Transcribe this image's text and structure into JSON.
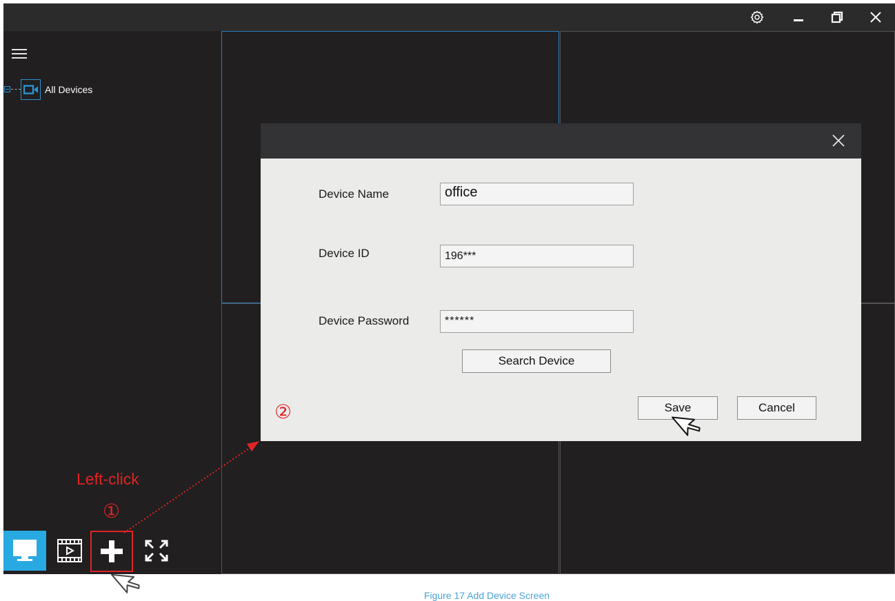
{
  "colors": {
    "accent": "#2a94d4",
    "annotation": "#e02424",
    "caption": "#4aa3d8"
  },
  "titlebar": {
    "icons": [
      "settings-icon",
      "minimize-icon",
      "restore-icon",
      "close-icon"
    ]
  },
  "sidebar": {
    "menu_icon": "hamburger-icon",
    "tree": {
      "root_label": "All Devices",
      "icon": "camera-icon"
    }
  },
  "toolbar": {
    "items": [
      "live-view-icon",
      "playback-icon",
      "add-device-icon",
      "fullscreen-icon"
    ]
  },
  "dialog": {
    "fields": [
      {
        "label": "Device Name",
        "value": "office"
      },
      {
        "label": "Device ID",
        "value": "196***"
      },
      {
        "label": "Device Password",
        "value": "******"
      }
    ],
    "search_button": "Search Device",
    "save_button": "Save",
    "cancel_button": "Cancel"
  },
  "annotations": {
    "step1": "①",
    "step1_action": "Left-click",
    "step2": "②"
  },
  "caption": "Figure 17 Add Device Screen"
}
